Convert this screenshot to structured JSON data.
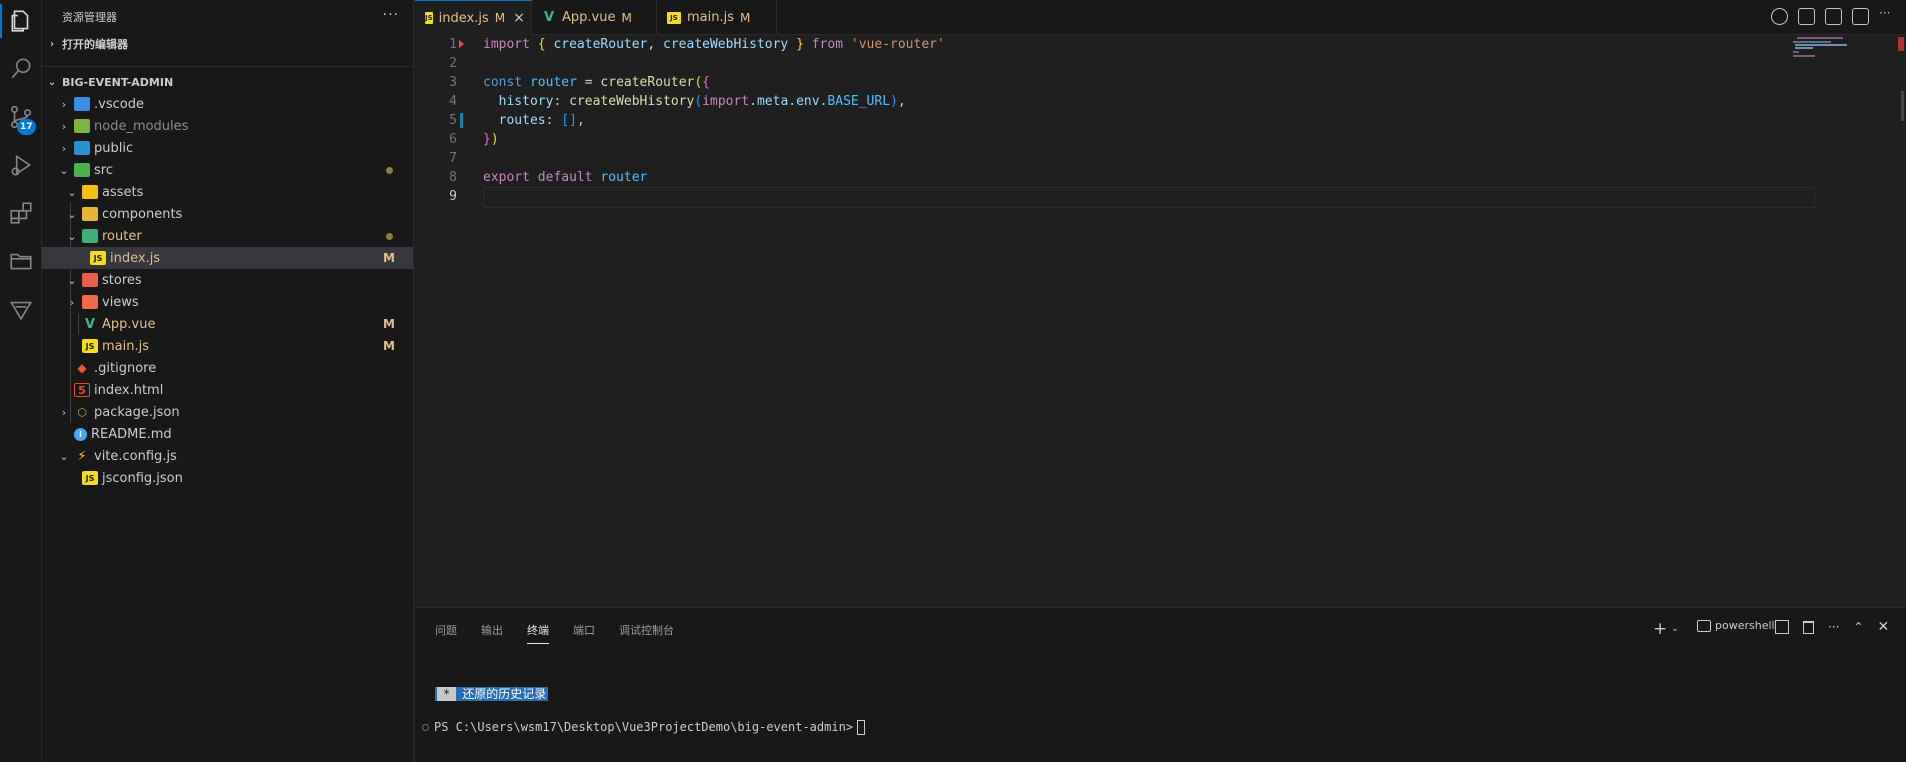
{
  "sidebar": {
    "title": "资源管理器",
    "more": "···",
    "open_editors": "打开的编辑器",
    "project": "BIG-EVENT-ADMIN",
    "tree": [
      {
        "label": ".vscode",
        "status": ""
      },
      {
        "label": "node_modules",
        "status": ""
      },
      {
        "label": "public",
        "status": ""
      },
      {
        "label": "src",
        "status": ""
      },
      {
        "label": "assets",
        "status": ""
      },
      {
        "label": "components",
        "status": ""
      },
      {
        "label": "router",
        "status": ""
      },
      {
        "label": "index.js",
        "status": "M"
      },
      {
        "label": "stores",
        "status": ""
      },
      {
        "label": "views",
        "status": ""
      },
      {
        "label": "App.vue",
        "status": "M"
      },
      {
        "label": "main.js",
        "status": "M"
      },
      {
        "label": ".gitignore",
        "status": ""
      },
      {
        "label": "index.html",
        "status": ""
      },
      {
        "label": "package.json",
        "status": ""
      },
      {
        "label": "README.md",
        "status": ""
      },
      {
        "label": "vite.config.js",
        "status": ""
      },
      {
        "label": "jsconfig.json",
        "status": ""
      }
    ]
  },
  "activity": {
    "scm_badge": "17"
  },
  "tabs": [
    {
      "label": "index.js",
      "status": "M",
      "close": "×"
    },
    {
      "label": "App.vue",
      "status": "M"
    },
    {
      "label": "main.js",
      "status": "M"
    }
  ],
  "editor": {
    "line_numbers": [
      "1",
      "2",
      "3",
      "4",
      "5",
      "6",
      "7",
      "8",
      "9"
    ],
    "code": {
      "l1_import": "import",
      "l1_ob": "{",
      "l1_names": " createRouter, createWebHistory ",
      "l1_cb": "}",
      "l1_from": " from ",
      "l1_str": "'vue-router'",
      "l3_const": "const",
      "l3_router": " router",
      "l3_eq": " = ",
      "l3_fn": "createRouter",
      "l3_op": "(",
      "l3_ob": "{",
      "l4_key": "  history",
      "l4_colon": ": ",
      "l4_fn": "createWebHistory",
      "l4_op": "(",
      "l4_import": "import",
      "l4_meta": ".meta.env.",
      "l4_const": "BASE_URL",
      "l4_cp": ")",
      "l4_comma": ",",
      "l5_key": "  routes",
      "l5_colon": ": ",
      "l5_arr": "[]",
      "l5_comma": ",",
      "l6_cb": "}",
      "l6_cp": ")",
      "l8_export": "export default",
      "l8_router": " router"
    }
  },
  "panel": {
    "tabs": [
      "问题",
      "输出",
      "终端",
      "端口",
      "调试控制台"
    ],
    "shell": "powershell",
    "restored_star": "*",
    "restored_text": "还原的历史记录",
    "prompt": "PS C:\\Users\\wsm17\\Desktop\\Vue3ProjectDemo\\big-event-admin>"
  }
}
